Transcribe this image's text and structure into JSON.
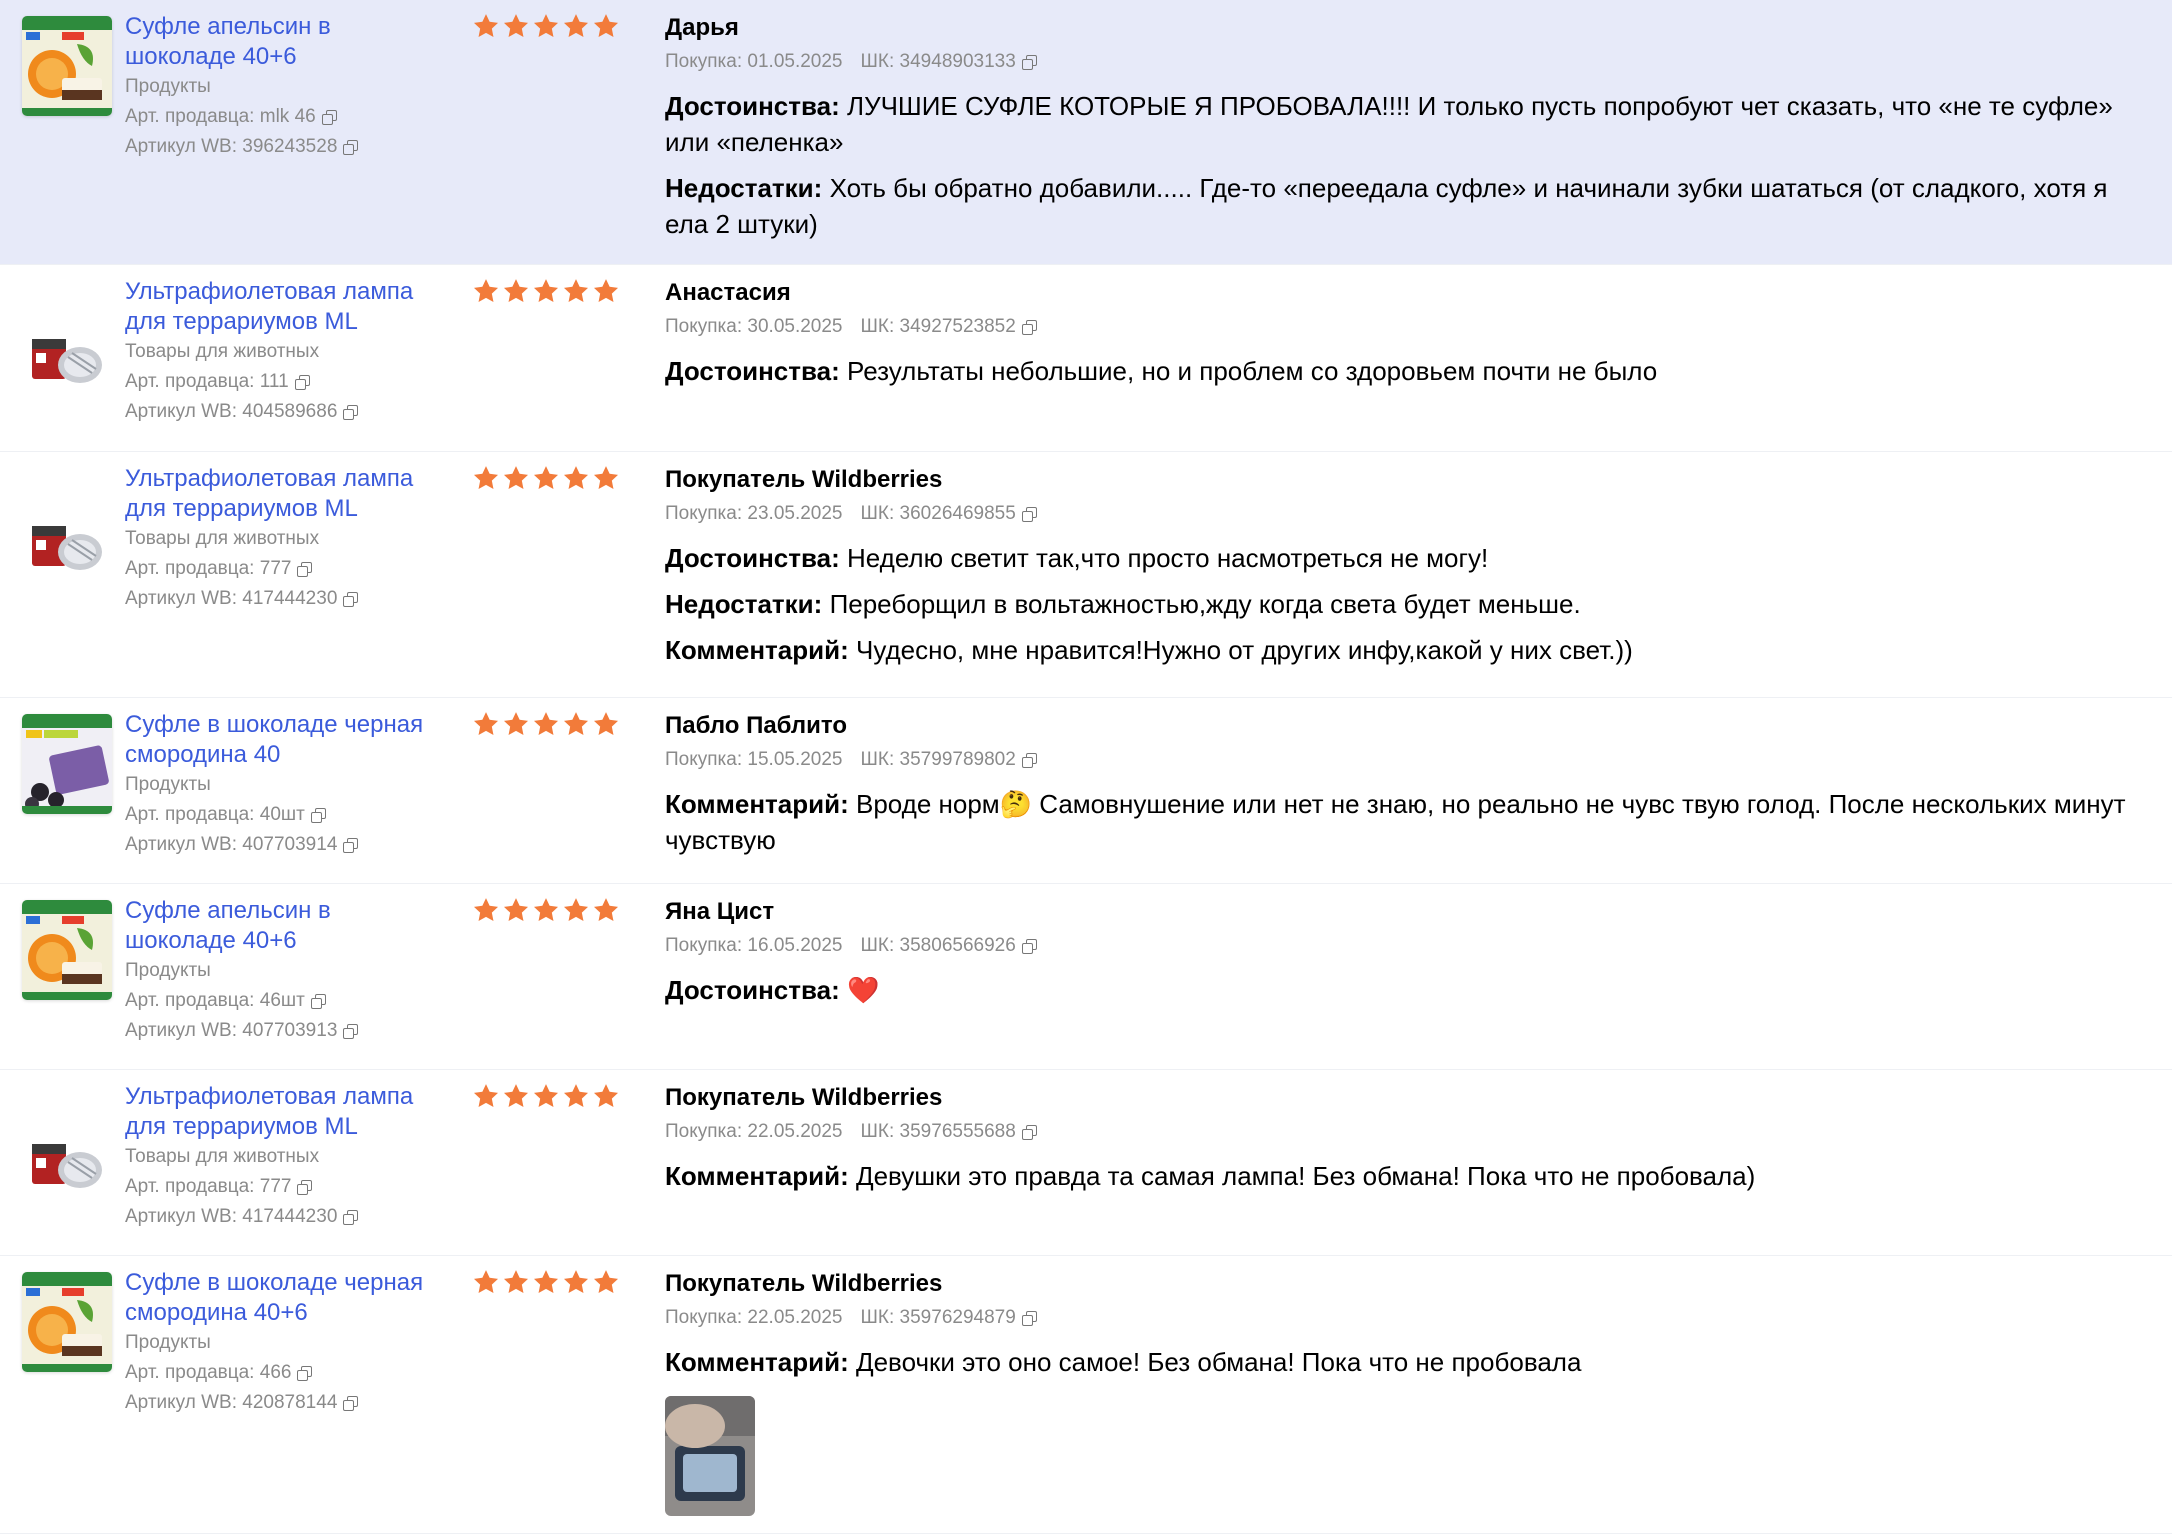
{
  "labels": {
    "seller_prefix": "Арт. продавца:",
    "wb_prefix": "Артикул WB:",
    "purchase_prefix": "Покупка:",
    "sk_prefix": "ШК:",
    "pros": "Достоинства:",
    "cons": "Недостатки:",
    "comment": "Комментарий:"
  },
  "colors": {
    "accent": "#3b5bdb",
    "star": "#f27b3a",
    "highlight": "#e7eaf9"
  },
  "reviews": [
    {
      "product": "Суфле апельсин в шоколаде 40+6",
      "category": "Продукты",
      "seller_article": "mlk 46",
      "wb_article": "396243528",
      "thumb": "souffle-orange",
      "rating": 5,
      "author": "Дарья",
      "purchase_date": "01.05.2025",
      "sk": "34948903133",
      "pros": "ЛУЧШИЕ СУФЛЕ КОТОРЫЕ Я ПРОБОВАЛА!!!! И только пусть попробуют чет сказать, что «не те суфле» или «пеленка»",
      "cons": "Хоть бы обратно добавили..... Где-то «переедала суфле» и начинали зубки шататься (от сладкого, хотя я ела 2 штуки)",
      "comment": ""
    },
    {
      "product": "Ультрафиолетовая лампа для террариумов ML",
      "category": "Товары для животных",
      "seller_article": "111",
      "wb_article": "404589686",
      "thumb": "uv-lamp",
      "rating": 5,
      "author": "Анастасия",
      "purchase_date": "30.05.2025",
      "sk": "34927523852",
      "pros": "Результаты небольшие, но и проблем со здоровьем почти не было",
      "cons": "",
      "comment": ""
    },
    {
      "product": "Ультрафиолетовая лампа для террариумов ML",
      "category": "Товары для животных",
      "seller_article": "777",
      "wb_article": "417444230",
      "thumb": "uv-lamp",
      "rating": 5,
      "author": "Покупатель Wildberries",
      "purchase_date": "23.05.2025",
      "sk": "36026469855",
      "pros": "Неделю светит так,что просто насмотреться не могу!",
      "cons": "Переборщил в вольтажностью,жду когда света будет меньше.",
      "comment": "Чудесно, мне нравится!Нужно от других инфу,какой у них свет.))"
    },
    {
      "product": "Суфле в шоколаде черная смородина 40",
      "category": "Продукты",
      "seller_article": "40шт",
      "wb_article": "407703914",
      "thumb": "souffle-currant",
      "rating": 5,
      "author": "Пабло Паблито",
      "purchase_date": "15.05.2025",
      "sk": "35799789802",
      "pros": "",
      "cons": "",
      "comment": "Вроде норм🤔 Самовнушение или нет не знаю, но реально не чувс твую голод. После нескольких минут чувствую"
    },
    {
      "product": "Суфле апельсин в шоколаде 40+6",
      "category": "Продукты",
      "seller_article": "46шт",
      "wb_article": "407703913",
      "thumb": "souffle-orange",
      "rating": 5,
      "author": "Яна Цист",
      "purchase_date": "16.05.2025",
      "sk": "35806566926",
      "pros": "❤️",
      "cons": "",
      "comment": ""
    },
    {
      "product": "Ультрафиолетовая лампа для террариумов ML",
      "category": "Товары для животных",
      "seller_article": "777",
      "wb_article": "417444230",
      "thumb": "uv-lamp",
      "rating": 5,
      "author": "Покупатель Wildberries",
      "purchase_date": "22.05.2025",
      "sk": "35976555688",
      "pros": "",
      "cons": "",
      "comment": "Девушки это правда та самая лампа! Без обмана! Пока что не пробовала)"
    },
    {
      "product": "Суфле в шоколаде черная смородина 40+6",
      "category": "Продукты",
      "seller_article": "466",
      "wb_article": "420878144",
      "thumb": "souffle-orange",
      "rating": 5,
      "author": "Покупатель Wildberries",
      "purchase_date": "22.05.2025",
      "sk": "35976294879",
      "pros": "",
      "cons": "",
      "comment": "Девочки это оно самое! Без обмана! Пока что не пробовала",
      "photo": "review-photo"
    }
  ]
}
